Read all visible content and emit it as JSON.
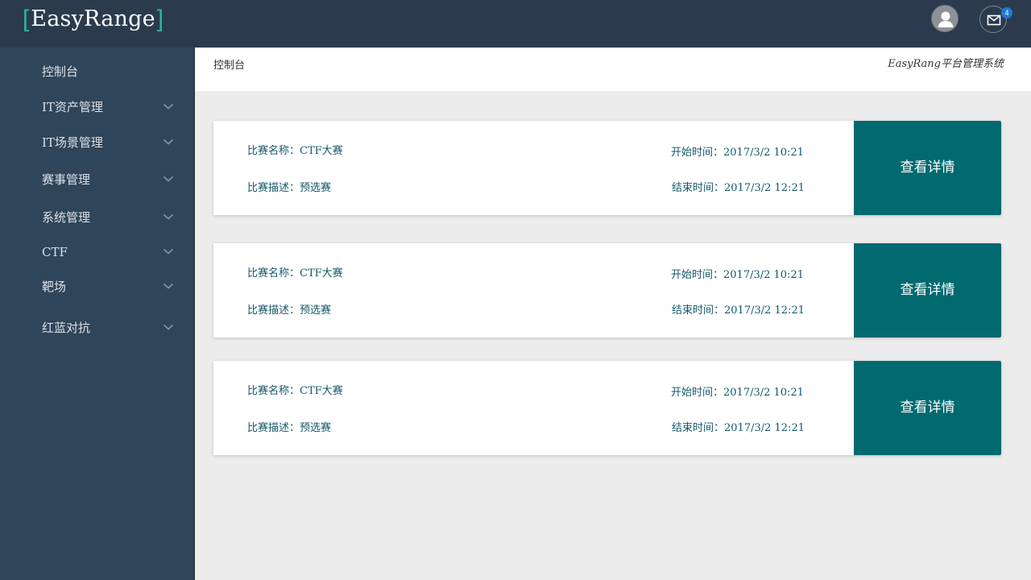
{
  "app": {
    "logo_text": "EasyRange",
    "bracket_left": "[",
    "bracket_right": "]",
    "notification_count": "4",
    "user_icon": "user-icon",
    "mail_icon": "mail-icon",
    "accent_color": "#2bb5a6",
    "topbar_color": "#2b3b4d",
    "sidebar_color": "#2f4559",
    "button_color": "#006a70",
    "badge_color": "#1e78d8"
  },
  "sidebar": {
    "items": [
      {
        "label": "控制台",
        "has_submenu": false
      },
      {
        "label": "IT资产管理",
        "has_submenu": true
      },
      {
        "label": "IT场景管理",
        "has_submenu": true
      },
      {
        "label": "赛事管理",
        "has_submenu": true
      },
      {
        "label": "系统管理",
        "has_submenu": true
      },
      {
        "label": "CTF",
        "has_submenu": true
      },
      {
        "label": "靶场",
        "has_submenu": true
      },
      {
        "label": "红蓝对抗",
        "has_submenu": true
      }
    ]
  },
  "header": {
    "breadcrumb": "控制台",
    "system_name": "EasyRang平台管理系统"
  },
  "competitions": [
    {
      "name": "比赛名称：CTF大赛",
      "desc": "比赛描述：预选赛",
      "start": "开始时间：2017/3/2 10:21",
      "end": "结束时间：2017/3/2 12:21",
      "button": "查看详情"
    },
    {
      "name": "比赛名称：CTF大赛",
      "desc": "比赛描述：预选赛",
      "start": "开始时间：2017/3/2 10:21",
      "end": "结束时间：2017/3/2 12:21",
      "button": "查看详情"
    },
    {
      "name": "比赛名称：CTF大赛",
      "desc": "比赛描述：预选赛",
      "start": "开始时间：2017/3/2 10:21",
      "end": "结束时间：2017/3/2 12:21",
      "button": "查看详情"
    }
  ]
}
